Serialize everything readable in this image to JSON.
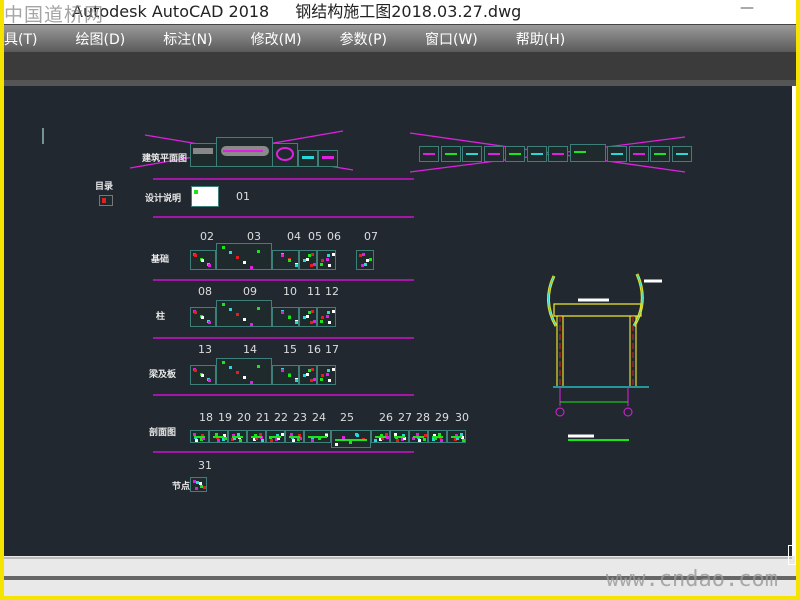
{
  "window": {
    "app_title": "Autodesk AutoCAD 2018",
    "file_name": "钢结构施工图2018.03.27.dwg",
    "minimize": "—"
  },
  "menu": [
    "具(T)",
    "绘图(D)",
    "标注(N)",
    "修改(M)",
    "参数(P)",
    "窗口(W)",
    "帮助(H)"
  ],
  "drawing": {
    "groups": {
      "plan": "建筑平面图",
      "index": "目录",
      "design_notes": "设计说明",
      "foundation": "基础",
      "column": "柱",
      "beam_slab": "梁及板",
      "section": "剖面图",
      "node": "节点"
    },
    "numbers": {
      "notes": [
        "01"
      ],
      "foundation": [
        "02",
        "03",
        "04",
        "05",
        "06",
        "07"
      ],
      "column": [
        "08",
        "09",
        "10",
        "11",
        "12"
      ],
      "beam_slab": [
        "13",
        "14",
        "15",
        "16",
        "17"
      ],
      "section": [
        "18",
        "19",
        "20",
        "21",
        "22",
        "23",
        "24",
        "25",
        "26",
        "27",
        "28",
        "29",
        "30"
      ],
      "node": [
        "31"
      ]
    }
  },
  "colors": {
    "canvas": "#212830",
    "divider": "#a316a8",
    "sheet_border": "#3e7f7a",
    "frame": "#e6e02a",
    "accent_green": "#1be41b",
    "accent_magenta": "#e020e0"
  },
  "watermarks": {
    "top": "中国道桥网",
    "bottom": "www.cndao.com"
  }
}
